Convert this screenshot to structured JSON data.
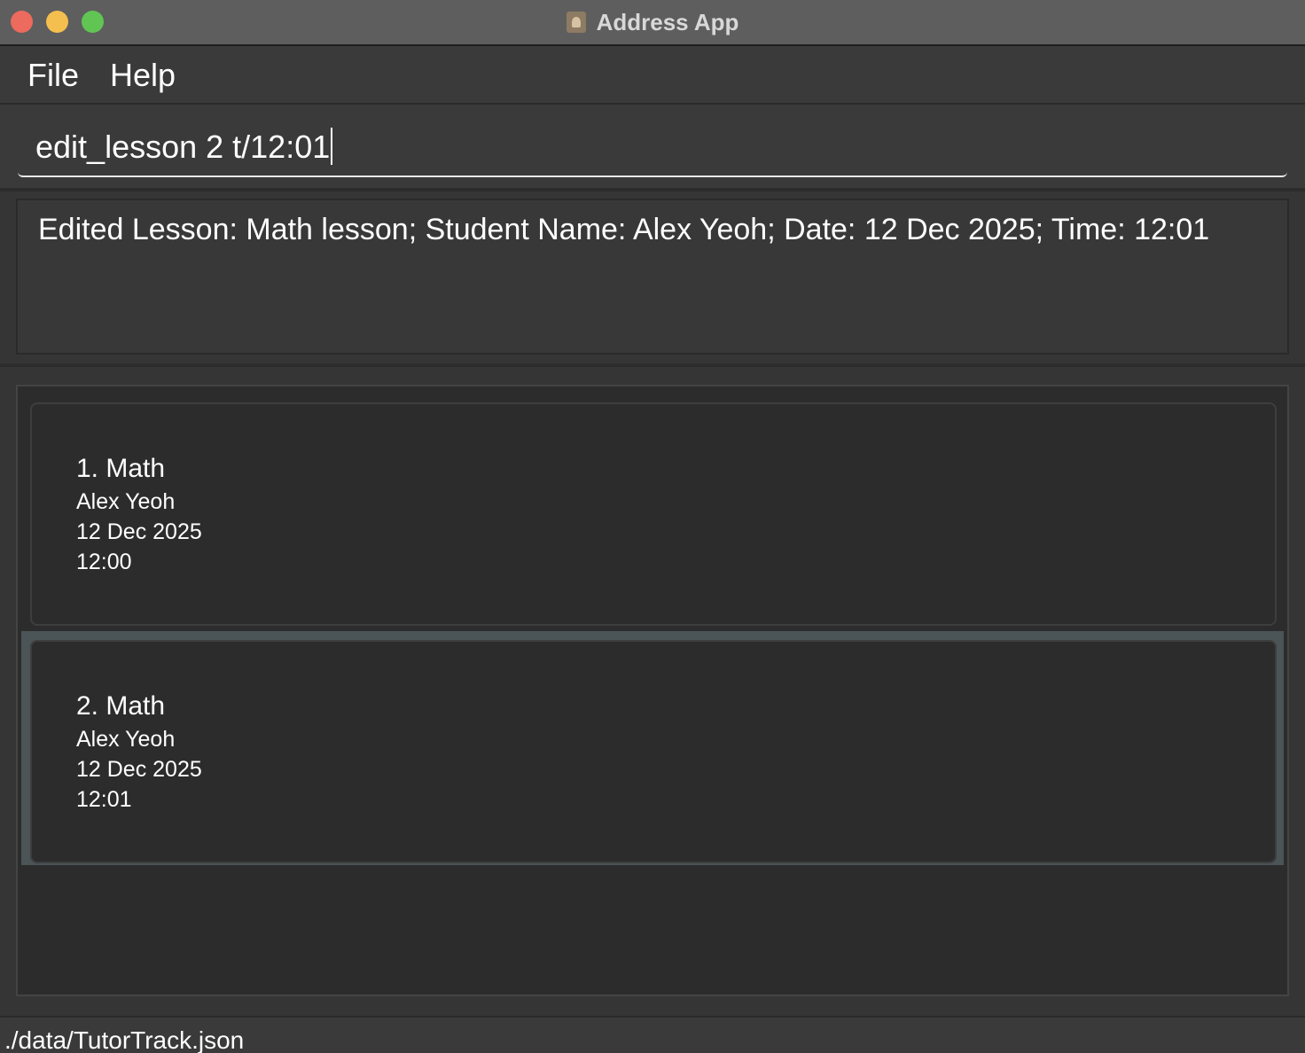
{
  "window": {
    "title": "Address App"
  },
  "menu": {
    "file": "File",
    "help": "Help"
  },
  "command": {
    "value": "edit_lesson 2 t/12:01"
  },
  "result": {
    "text": "Edited Lesson: Math lesson; Student Name: Alex Yeoh; Date: 12 Dec 2025; Time: 12:01"
  },
  "lessons": [
    {
      "title": "1. Math",
      "student": "Alex Yeoh",
      "date": "12 Dec 2025",
      "time": "12:00",
      "selected": false
    },
    {
      "title": "2. Math",
      "student": "Alex Yeoh",
      "date": "12 Dec 2025",
      "time": "12:01",
      "selected": true
    }
  ],
  "status": {
    "path": "./data/TutorTrack.json"
  },
  "colors": {
    "close": "#ed6a5e",
    "minimize": "#f5bf4f",
    "zoom": "#61c554",
    "selection": "#4b5457"
  }
}
